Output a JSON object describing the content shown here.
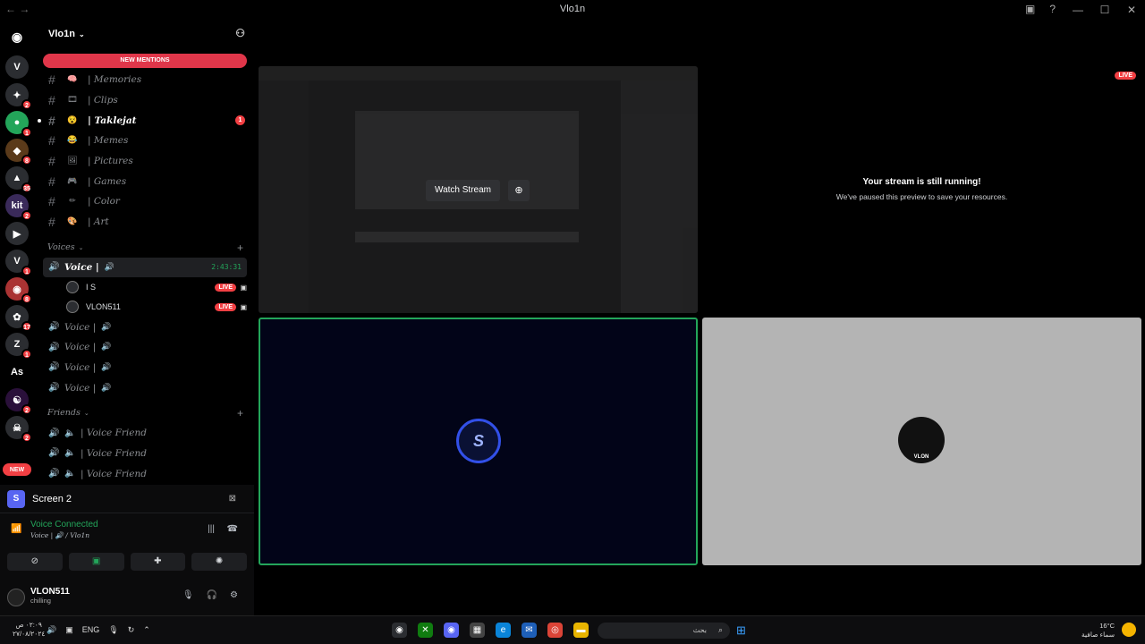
{
  "window": {
    "title": "Vlo1n",
    "nav": "← →"
  },
  "servers": [
    {
      "label": "V",
      "badge": "",
      "color": "#2b2d31"
    },
    {
      "label": "✦",
      "badge": "2",
      "color": "#2b2d31"
    },
    {
      "label": "●",
      "badge": "1",
      "color": "#23a55a"
    },
    {
      "label": "◆",
      "badge": "8",
      "color": "#5a3a1a"
    },
    {
      "label": "▲",
      "badge": "35",
      "color": "#2b2d31"
    },
    {
      "label": "kit",
      "badge": "2",
      "color": "#3a2a5a"
    },
    {
      "label": "▶",
      "badge": "",
      "color": "#2b2d31"
    },
    {
      "label": "V",
      "badge": "1",
      "color": "#2b2d31"
    },
    {
      "label": "◉",
      "badge": "8",
      "color": "#a33"
    },
    {
      "label": "✿",
      "badge": "17",
      "color": "#2b2d31"
    },
    {
      "label": "Z",
      "badge": "1",
      "color": "#2b2d31"
    },
    {
      "label": "As",
      "badge": "",
      "color": "#000"
    },
    {
      "label": "☯",
      "badge": "2",
      "color": "#2a103a"
    },
    {
      "label": "☠",
      "badge": "2",
      "color": "#2b2d31"
    }
  ],
  "servers_new": "NEW",
  "guild": {
    "name": "Vlo1n",
    "new_mentions": "NEW MENTIONS"
  },
  "text_channels": [
    {
      "name": "| Memories",
      "emoji": "🧠",
      "bold": false,
      "ping": ""
    },
    {
      "name": "| Clips",
      "emoji": "🎞",
      "bold": false,
      "ping": ""
    },
    {
      "name": "| Taklejat",
      "emoji": "😵",
      "bold": true,
      "ping": "1"
    },
    {
      "name": "| Memes",
      "emoji": "😂",
      "bold": false,
      "ping": ""
    },
    {
      "name": "| Pictures",
      "emoji": "🖼",
      "bold": false,
      "ping": ""
    },
    {
      "name": "| Games",
      "emoji": "🎮",
      "bold": false,
      "ping": ""
    },
    {
      "name": "| Color",
      "emoji": "✏",
      "bold": false,
      "ping": ""
    },
    {
      "name": "| Art",
      "emoji": "🎨",
      "bold": false,
      "ping": ""
    }
  ],
  "voices_category": "Voices",
  "active_voice": {
    "name": "Voice |",
    "timer": "2:43:31"
  },
  "voice_users": [
    {
      "name": "I S",
      "live": "LIVE"
    },
    {
      "name": "VLON511",
      "live": "LIVE"
    }
  ],
  "voice_channels": [
    "Voice |",
    "Voice |",
    "Voice |",
    "Voice |"
  ],
  "friends_category": "Friends",
  "friend_channels": [
    "| Voice Friend",
    "| Voice Friend",
    "| Voice Friend"
  ],
  "panel": {
    "screen_label": "Screen 2",
    "screen_icon": "S",
    "voice_status": "Voice Connected",
    "voice_path": "Voice | 🔊 / Vlo1n",
    "username": "VLON511",
    "user_status": "chilling"
  },
  "stream": {
    "watch_label": "Watch Stream",
    "live_badge": "LIVE",
    "paused_title": "Your stream is still running!",
    "paused_sub": "We've paused this preview to save your resources.",
    "avatar2_label": "VLON"
  },
  "taskbar": {
    "time": "٠٢:٠٩ ص",
    "date": "٢٧/٠٨/٢٠٢٤",
    "lang": "ENG",
    "search": "بحث",
    "temp": "16°C",
    "weather": "سماء صافية"
  }
}
